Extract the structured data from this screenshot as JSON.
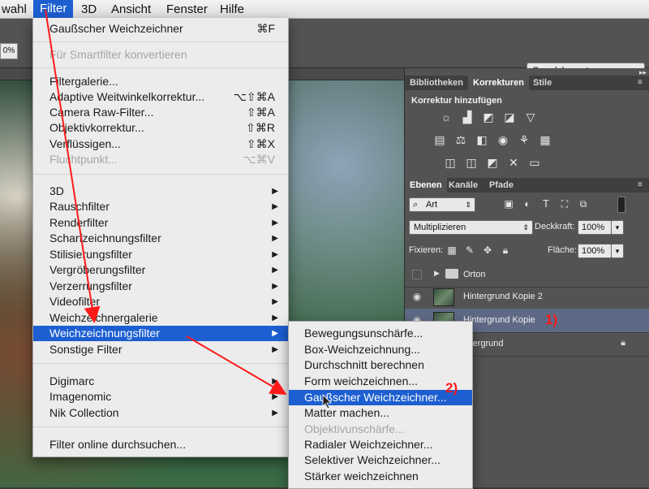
{
  "menubar": {
    "items": [
      "wahl",
      "Filter",
      "3D",
      "Ansicht",
      "Fenster",
      "Hilfe"
    ]
  },
  "options_bar": {
    "zoom": "0%",
    "workspace": "Grundelemente"
  },
  "filter_menu": {
    "last_filter": {
      "label": "Gaußscher Weichzeichner",
      "shortcut": "⌘F"
    },
    "smart_filter": "Für Smartfilter konvertieren",
    "group1": [
      {
        "label": "Filtergalerie...",
        "shortcut": ""
      },
      {
        "label": "Adaptive Weitwinkelkorrektur...",
        "shortcut": "⌥⇧⌘A"
      },
      {
        "label": "Camera Raw-Filter...",
        "shortcut": "⇧⌘A"
      },
      {
        "label": "Objektivkorrektur...",
        "shortcut": "⇧⌘R"
      },
      {
        "label": "Verflüssigen...",
        "shortcut": "⇧⌘X"
      },
      {
        "label": "Fluchtpunkt...",
        "shortcut": "⌥⌘V",
        "disabled": true
      }
    ],
    "group2": [
      "3D",
      "Rauschfilter",
      "Renderfilter",
      "Scharfzeichnungsfilter",
      "Stilisierungsfilter",
      "Vergröberungsfilter",
      "Verzerrungsfilter",
      "Videofilter",
      "Weichzeichnergalerie",
      "Weichzeichnungsfilter",
      "Sonstige Filter"
    ],
    "group2_selected": "Weichzeichnungsfilter",
    "group3": [
      "Digimarc",
      "Imagenomic",
      "Nik Collection"
    ],
    "browse": "Filter online durchsuchen..."
  },
  "blur_submenu": {
    "items": [
      {
        "label": "Bewegungsunschärfe..."
      },
      {
        "label": "Box-Weichzeichnung..."
      },
      {
        "label": "Durchschnitt berechnen"
      },
      {
        "label": "Form weichzeichnen..."
      },
      {
        "label": "Gaußscher Weichzeichner...",
        "selected": true
      },
      {
        "label": "Matter machen..."
      },
      {
        "label": "Objektivunschärfe...",
        "disabled": true
      },
      {
        "label": "Radialer Weichzeichner..."
      },
      {
        "label": "Selektiver Weichzeichner..."
      },
      {
        "label": "Stärker weichzeichnen"
      }
    ]
  },
  "panels": {
    "top_tabs": [
      "Bibliotheken",
      "Korrekturen",
      "Stile"
    ],
    "korrektur_title": "Korrektur hinzufügen",
    "layer_tabs": [
      "Ebenen",
      "Kanäle",
      "Pfade"
    ],
    "kind_filter": "Art",
    "blend_mode": "Multiplizieren",
    "opacity_label": "Deckkraft:",
    "opacity_value": "100%",
    "lock_label": "Fixieren:",
    "fill_label": "Fläche:",
    "fill_value": "100%",
    "layers": [
      {
        "name": "Orton",
        "type": "group",
        "visible": false
      },
      {
        "name": "Hintergrund Kopie 2",
        "visible": true
      },
      {
        "name": "Hintergrund Kopie",
        "visible": true,
        "selected": true
      },
      {
        "name": "intergrund",
        "locked": true
      }
    ]
  },
  "annotations": [
    "1)",
    "2)"
  ],
  "colors": {
    "menu_highlight": "#1d5fd0",
    "annotation": "#ff1a1a",
    "panel_bg": "#535353"
  }
}
